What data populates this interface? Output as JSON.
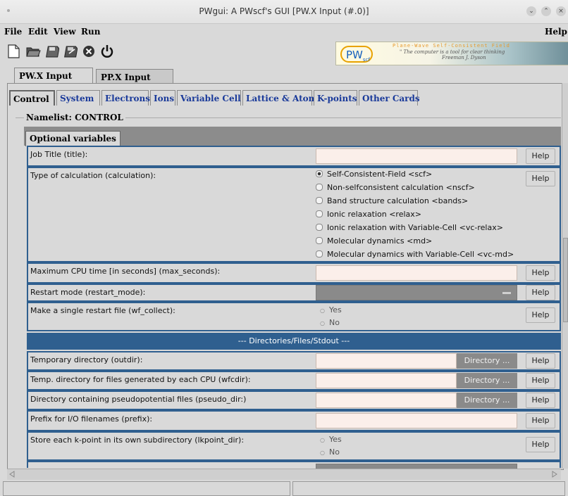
{
  "window": {
    "title": "PWgui: A PWscf's GUI  [PW.X Input (#.0)]"
  },
  "menu": {
    "file": "File",
    "edit": "Edit",
    "view": "View",
    "run": "Run",
    "help": "Help"
  },
  "banner": {
    "logo": "PW",
    "logo_sub": "scf",
    "tagline": "Plane-Wave Self-Consistent Field",
    "quote": "\" The computer is a tool for clear thinking",
    "author": "Freeman J. Dyson"
  },
  "tabs": [
    {
      "label": "PW.X Input (#.0)"
    },
    {
      "label": "PP.X Input (#.1)"
    }
  ],
  "subtabs": [
    {
      "label": "Control"
    },
    {
      "label": "System"
    },
    {
      "label": "Electrons"
    },
    {
      "label": "Ions"
    },
    {
      "label": "Variable Cell"
    },
    {
      "label": "Lattice & Atoms"
    },
    {
      "label": "K-points"
    },
    {
      "label": "Other Cards"
    }
  ],
  "namelist": "Namelist: CONTROL",
  "optional_tab": "Optional variables",
  "help_label": "Help",
  "directory_label": "Directory ...",
  "rows": {
    "title": "Job Title (title):",
    "calculation": "Type of calculation (calculation):",
    "max_seconds": "Maximum CPU time [in seconds] (max_seconds):",
    "restart_mode": "Restart mode (restart_mode):",
    "wf_collect": "Make a single restart file (wf_collect):",
    "section": "--- Directories/Files/Stdout ---",
    "outdir": "Temporary directory (outdir):",
    "wfcdir": "Temp. directory for files generated by each CPU (wfcdir):",
    "pseudo_dir": "Directory containing pseudopotential files (pseudo_dir:)",
    "prefix": "Prefix for I/O filenames (prefix):",
    "lkpoint_dir": "Store each k-point in its own subdirectory (lkpoint_dir):"
  },
  "calculation_options": [
    "Self-Consistent-Field  <scf>",
    "Non-selfconsistent calculation  <nscf>",
    "Band structure calculation  <bands>",
    "Ionic relaxation  <relax>",
    "Ionic relaxation with Variable-Cell  <vc-relax>",
    "Molecular dynamics  <md>",
    "Molecular dynamics with Variable-Cell  <vc-md>"
  ],
  "calculation_selected": 0,
  "yes_label": "Yes",
  "no_label": "No"
}
